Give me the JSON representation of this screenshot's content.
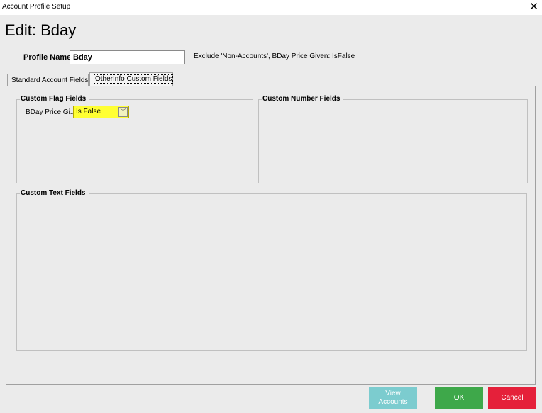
{
  "window": {
    "title": "Account Profile Setup",
    "close_glyph": "✕"
  },
  "heading": "Edit: Bday",
  "profile": {
    "name_label": "Profile Name:",
    "name_value": "Bday",
    "summary": "Exclude 'Non-Accounts', BDay Price Given: IsFalse"
  },
  "tabs": [
    {
      "label": "Standard Account Fields",
      "selected": false
    },
    {
      "label": "OtherInfo Custom Fields",
      "selected": true
    }
  ],
  "groups": {
    "flag": {
      "legend": "Custom Flag Fields",
      "field_label": "BDay Price Gi...",
      "field_value": "Is False",
      "highlight_color": "#ffff33"
    },
    "number": {
      "legend": "Custom Number Fields"
    },
    "text": {
      "legend": "Custom Text Fields"
    }
  },
  "buttons": {
    "view_line1": "View",
    "view_line2": "Accounts",
    "ok": "OK",
    "cancel": "Cancel"
  },
  "colors": {
    "ok": "#3ea84a",
    "cancel": "#e5203a",
    "view": "#7ccccf"
  }
}
